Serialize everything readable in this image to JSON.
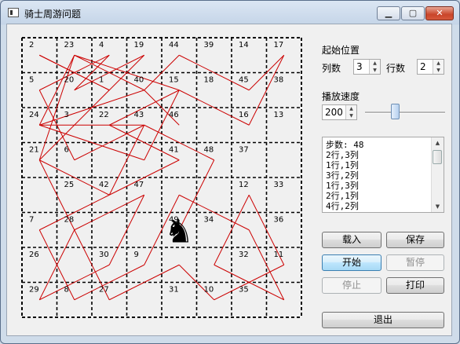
{
  "window": {
    "title": "骑士周游问题",
    "buttons": {
      "minimize": "▁",
      "maximize": "▢",
      "close": "✕"
    }
  },
  "board": {
    "rows": [
      [
        "2",
        "23",
        "4",
        "19",
        "44",
        "39",
        "14",
        "17"
      ],
      [
        "5",
        "20",
        "1",
        "40",
        "15",
        "18",
        "45",
        "38"
      ],
      [
        "24",
        "3",
        "22",
        "43",
        "46",
        "",
        "16",
        "13"
      ],
      [
        "21",
        "6",
        "",
        "",
        "41",
        "48",
        "37",
        ""
      ],
      [
        "",
        "25",
        "42",
        "47",
        "",
        "",
        "12",
        "33"
      ],
      [
        "7",
        "28",
        "",
        "",
        "49",
        "34",
        "",
        "36"
      ],
      [
        "26",
        "",
        "30",
        "9",
        "",
        "",
        "32",
        "11"
      ],
      [
        "29",
        "8",
        "27",
        "",
        "31",
        "10",
        "35",
        ""
      ]
    ],
    "knight": "♞",
    "path": [
      [
        4,
        2
      ],
      [
        3,
        1
      ],
      [
        4,
        0
      ],
      [
        6,
        1
      ],
      [
        7,
        0
      ],
      [
        6,
        2
      ],
      [
        4,
        1
      ],
      [
        3,
        3
      ],
      [
        0,
        2
      ],
      [
        1,
        0
      ],
      [
        0,
        3
      ],
      [
        2,
        1
      ],
      [
        0,
        0
      ],
      [
        2,
        1
      ],
      [
        3,
        0
      ],
      [
        1,
        1
      ],
      [
        2,
        0
      ],
      [
        0,
        1
      ],
      [
        1,
        3
      ],
      [
        3,
        2
      ],
      [
        2,
        4
      ],
      [
        0,
        3
      ],
      [
        1,
        5
      ],
      [
        0,
        7
      ],
      [
        2,
        6
      ],
      [
        3,
        4
      ],
      [
        1,
        5
      ],
      [
        2,
        7
      ],
      [
        4,
        6
      ],
      [
        5,
        7
      ],
      [
        7,
        6
      ],
      [
        6,
        4
      ],
      [
        5,
        6
      ],
      [
        7,
        7
      ],
      [
        6,
        5
      ],
      [
        4,
        4
      ],
      [
        3,
        6
      ],
      [
        1,
        7
      ],
      [
        0,
        5
      ],
      [
        2,
        4
      ],
      [
        4,
        3
      ],
      [
        2,
        2
      ],
      [
        4,
        1
      ],
      [
        1,
        0
      ],
      [
        3,
        1
      ],
      [
        0,
        2
      ],
      [
        3,
        2
      ],
      [
        5,
        3
      ],
      [
        4,
        5
      ]
    ]
  },
  "position": {
    "heading": "起始位置",
    "col_label": "列数",
    "col_value": "3",
    "row_label": "行数",
    "row_value": "2"
  },
  "speed": {
    "heading": "播放速度",
    "value": "200",
    "slider_level": 0.35
  },
  "log": [
    "步数: 48",
    "2行,3列",
    "1行,1列",
    "3行,2列",
    "1行,3列",
    "2行,1列",
    "4行,2列"
  ],
  "actions": {
    "load": "载入",
    "save": "保存",
    "start": "开始",
    "pause": "暂停",
    "stop": "停止",
    "print": "打印",
    "exit": "退出"
  },
  "colors": {
    "path": "#cc0000",
    "grid": "#000000"
  },
  "arrows": {
    "up": "▲",
    "down": "▼"
  }
}
